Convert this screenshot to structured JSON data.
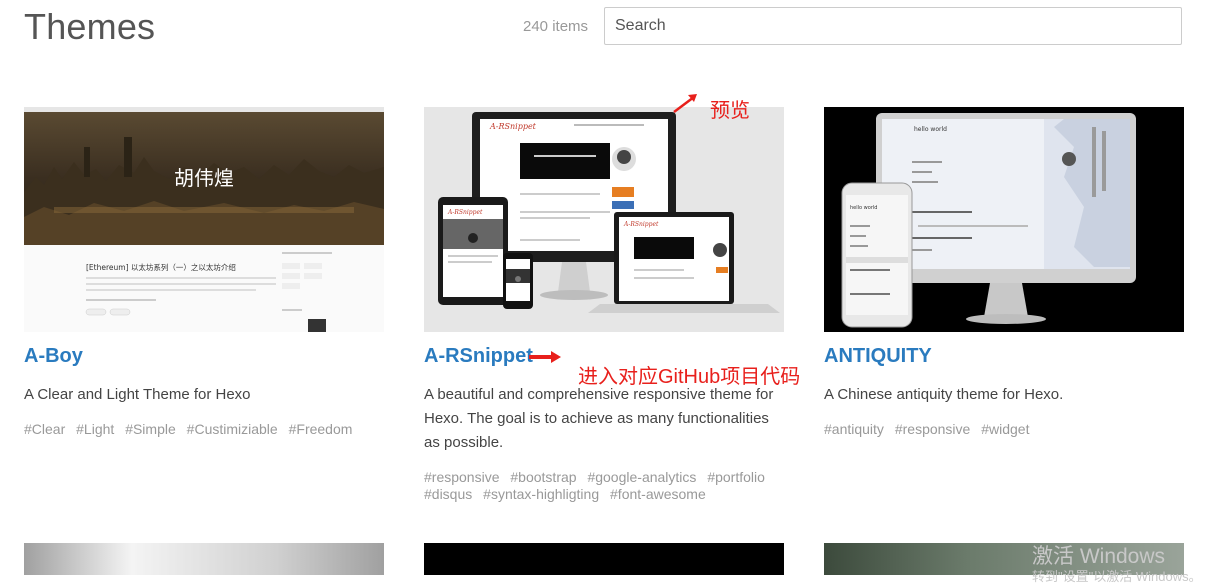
{
  "header": {
    "title": "Themes",
    "count": "240 items",
    "search_placeholder": "Search"
  },
  "themes": [
    {
      "name": "A-Boy",
      "description": "A Clear and Light Theme for Hexo",
      "tags": [
        "#Clear",
        "#Light",
        "#Simple",
        "#Custimiziable",
        "#Freedom"
      ],
      "preview": {
        "hero_text": "胡伟煌",
        "post_title": "[Ethereum] 以太坊系列（一）之以太坊介绍"
      }
    },
    {
      "name": "A-RSnippet",
      "description": "A beautiful and comprehensive responsive theme for Hexo. The goal is to achieve as many functionalities as possible.",
      "tags": [
        "#responsive",
        "#bootstrap",
        "#google-analytics",
        "#portfolio",
        "#disqus",
        "#syntax-highligting",
        "#font-awesome"
      ],
      "preview": {
        "logo_text": "A-RSnippet"
      }
    },
    {
      "name": "ANTIQUITY",
      "description": "A Chinese antiquity theme for Hexo.",
      "tags": [
        "#antiquity",
        "#responsive",
        "#widget"
      ],
      "preview": {
        "text": "hello world"
      }
    }
  ],
  "annotations": {
    "preview": "预览",
    "github": "进入对应GitHub项目代码"
  },
  "watermark": {
    "line1": "激活 Windows",
    "line2": "转到\"设置\"以激活 Windows。"
  },
  "colors": {
    "link": "#2a7bbf",
    "annotation": "#e8201c",
    "tag": "#999999"
  }
}
